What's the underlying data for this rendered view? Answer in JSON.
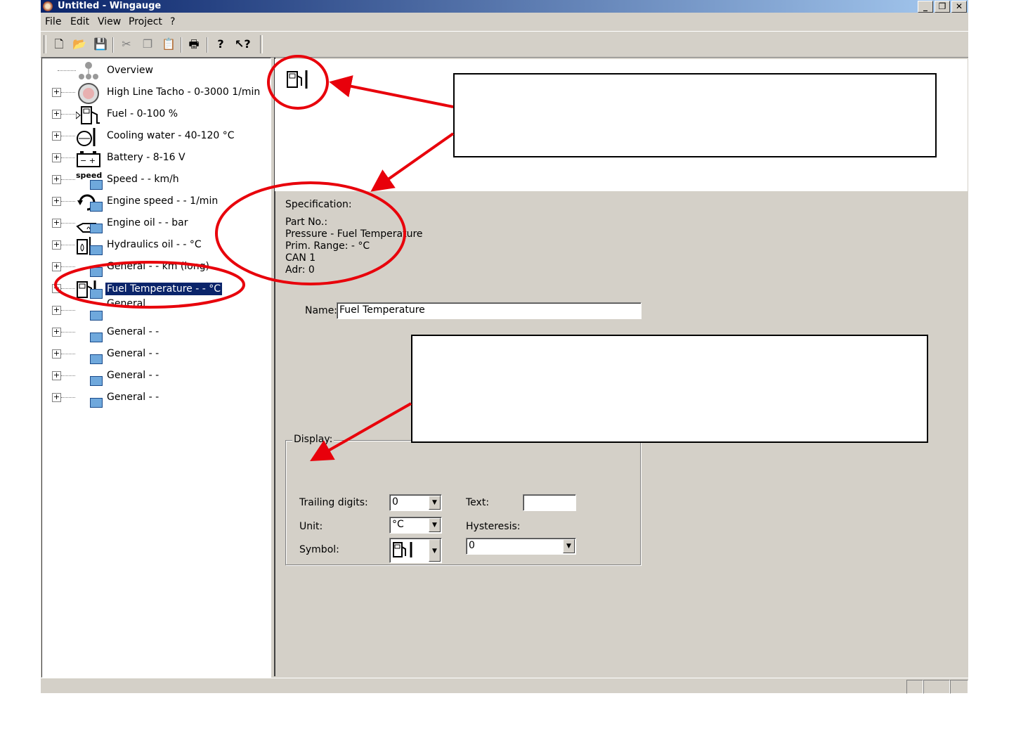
{
  "window": {
    "title": "Untitled - Wingauge"
  },
  "title_buttons": {
    "minimize": "_",
    "maximize": "❐",
    "close": "✕"
  },
  "menu": [
    {
      "label": "File"
    },
    {
      "label": "Edit"
    },
    {
      "label": "View"
    },
    {
      "label": "Project"
    },
    {
      "label": "?"
    }
  ],
  "toolbar": {
    "icons": [
      "new-icon",
      "open-icon",
      "save-icon",
      "cut-icon",
      "copy-icon",
      "paste-icon",
      "print-icon",
      "help-icon",
      "context-help-icon"
    ]
  },
  "tree": {
    "items": [
      {
        "label": "Overview"
      },
      {
        "label": "High Line Tacho - 0-3000 1/min"
      },
      {
        "label": "Fuel - 0-100 %"
      },
      {
        "label": "Cooling water - 40-120 °C"
      },
      {
        "label": "Battery - 8-16 V"
      },
      {
        "label": "Speed - - km/h"
      },
      {
        "label": "Engine speed - - 1/min"
      },
      {
        "label": "Engine oil - - bar"
      },
      {
        "label": "Hydraulics oil - - °C"
      },
      {
        "label": "General - - km (long)"
      },
      {
        "label": "Fuel Temperature - - °C"
      },
      {
        "label": "General"
      },
      {
        "label": "General - -"
      },
      {
        "label": "General - -"
      },
      {
        "label": "General - -"
      },
      {
        "label": "General - -"
      }
    ],
    "selected_index": 10,
    "speed_icon_text": "speed"
  },
  "specification": {
    "heading": "Specification:",
    "part_no": "Part No.:",
    "pressure": "Pressure - Fuel Temperature",
    "prim_range": "Prim. Range: - °C",
    "can": "CAN 1",
    "adr": "Adr: 0"
  },
  "name_field": {
    "label": "Name:",
    "value": "Fuel Temperature"
  },
  "display": {
    "group_label": "Display:",
    "trailing_digits_label": "Trailing digits:",
    "trailing_digits_value": "0",
    "unit_label": "Unit:",
    "unit_value": "°C",
    "symbol_label": "Symbol:",
    "text_label": "Text:",
    "text_value": "",
    "hysteresis_label": "Hysteresis:",
    "hysteresis_value": "0"
  },
  "colors": {
    "annotation_red": "#e8000b",
    "selection": "#0a246a",
    "face": "#d4d0c8"
  }
}
